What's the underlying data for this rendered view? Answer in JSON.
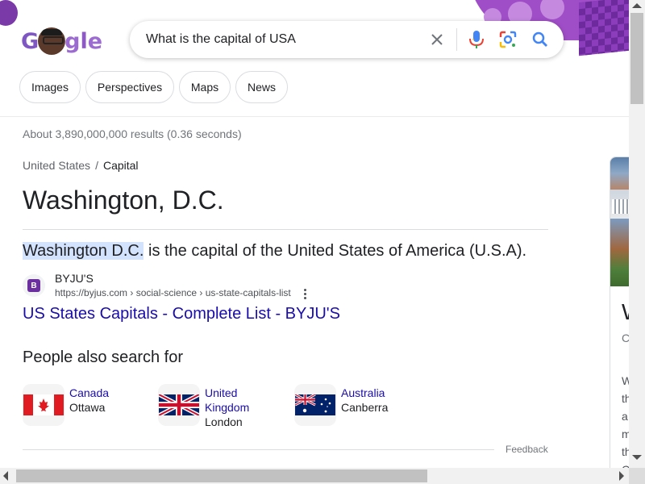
{
  "search": {
    "query": "What is the capital of USA"
  },
  "logo": {
    "letters": [
      "G",
      "o",
      "g",
      "l",
      "e"
    ],
    "colors": [
      "#7e57c2",
      "#7e57c2",
      "#9c6bd1",
      "#8e59c5",
      "#9c6bd1"
    ]
  },
  "chips": [
    {
      "label": "Images"
    },
    {
      "label": "Perspectives"
    },
    {
      "label": "Maps"
    },
    {
      "label": "News"
    }
  ],
  "result_stats": "About 3,890,000,000 results (0.36 seconds)",
  "breadcrumb": {
    "parent": "United States",
    "separator": "/",
    "current": "Capital"
  },
  "answer": "Washington, D.C.",
  "snippet": {
    "highlight": "Washington D.C.",
    "rest": " is the capital of the United States of America (U.S.A)."
  },
  "source": {
    "favicon_letter": "B",
    "name": "BYJU'S",
    "url": "https://byjus.com › social-science › us-state-capitals-list",
    "title": "US States Capitals - Complete List - BYJU'S"
  },
  "people_also_search": {
    "title": "People also search for",
    "items": [
      {
        "country": "Canada",
        "capital": "Ottawa",
        "flag": "canada-flag"
      },
      {
        "country": "United Kingdom",
        "country_lines": [
          "United",
          "Kingdom"
        ],
        "capital": "London",
        "flag": "uk-flag"
      },
      {
        "country": "Australia",
        "capital": "Canberra",
        "flag": "australia-flag"
      }
    ]
  },
  "feedback": "Feedback",
  "knowledge_panel": {
    "title_initial": "W",
    "subtitle_initial": "C",
    "text_initials": [
      "W",
      "th",
      "a",
      "m",
      "th",
      "C"
    ]
  },
  "colors": {
    "link": "#1a0dab",
    "highlight": "#d3e3fd",
    "doodle_purple": "#a04ec7"
  }
}
